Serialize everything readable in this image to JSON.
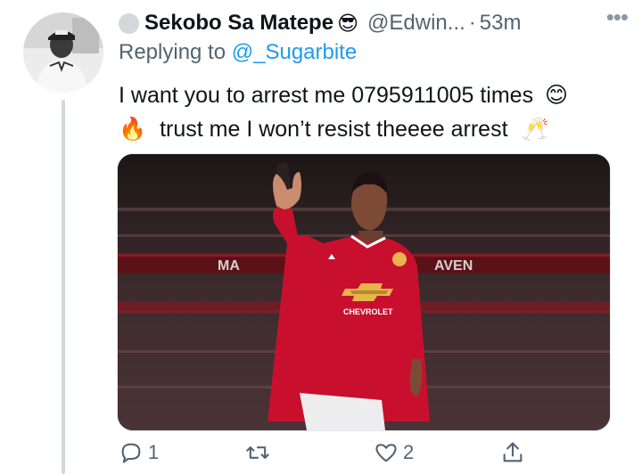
{
  "tweet": {
    "display_name": "Sekobo Sa Matepe",
    "name_emoji": "😎",
    "handle": "@Edwin...",
    "separator": "·",
    "time": "53m",
    "more_icon": "more-horizontal-icon",
    "replying_prefix": "Replying to",
    "replying_to": "@_Sugarbite",
    "text_line1": "I want you to arrest me 0795911005 times",
    "emoji_smile": "😊",
    "emoji_fire": "🔥",
    "text_line2": "trust me I won’t resist theeee arrest",
    "emoji_cheers": "🥂",
    "media_board_left": "MA",
    "media_board_right": "AVEN",
    "media_sponsor": "CHEVROLET",
    "actions": {
      "reply_count": "1",
      "retweet_count": "",
      "like_count": "2"
    }
  },
  "colors": {
    "link": "#1d9bf0",
    "secondary_text": "#536471",
    "kit_red": "#c8102e",
    "thread_line": "#cfd9de"
  }
}
